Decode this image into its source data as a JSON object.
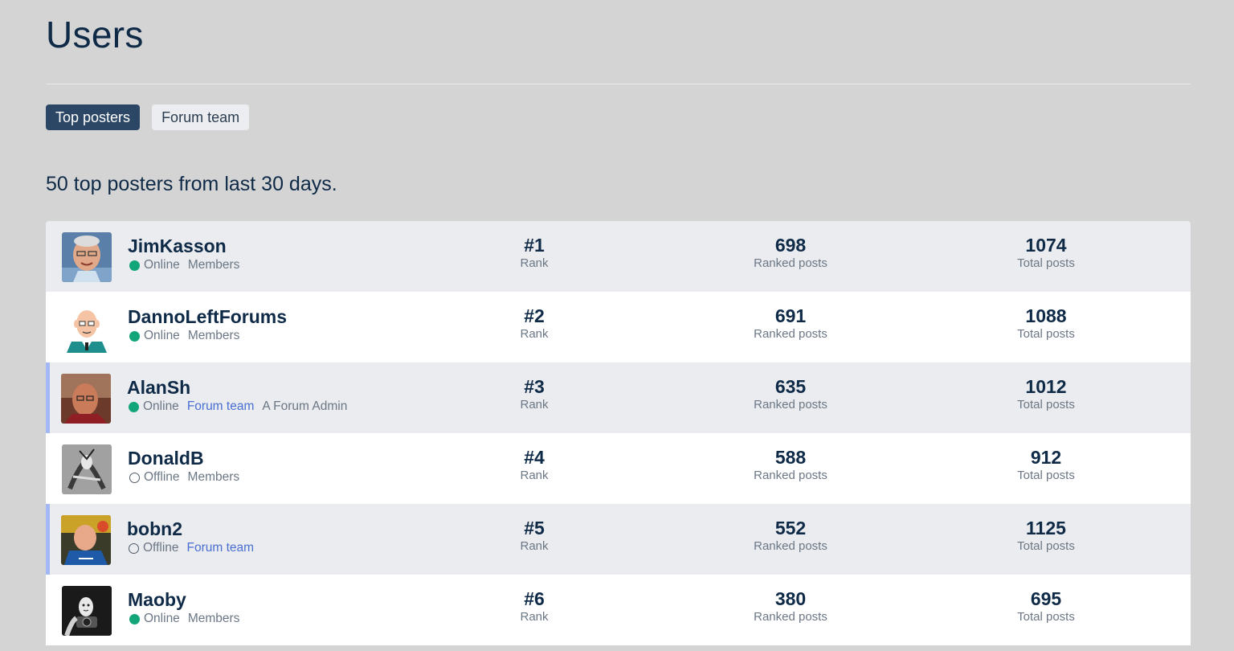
{
  "page": {
    "title": "Users"
  },
  "tabs": [
    {
      "label": "Top posters",
      "active": true
    },
    {
      "label": "Forum team",
      "active": false
    }
  ],
  "subtitle": "50 top posters from last 30 days.",
  "rows": [
    {
      "username": "JimKasson",
      "status": "Online",
      "online": true,
      "groups": [
        {
          "label": "Members",
          "link": false
        }
      ],
      "rank": "#1",
      "rank_label": "Rank",
      "ranked_posts": "698",
      "ranked_label": "Ranked posts",
      "total_posts": "1074",
      "total_label": "Total posts"
    },
    {
      "username": "DannoLeftForums",
      "status": "Online",
      "online": true,
      "groups": [
        {
          "label": "Members",
          "link": false
        }
      ],
      "rank": "#2",
      "rank_label": "Rank",
      "ranked_posts": "691",
      "ranked_label": "Ranked posts",
      "total_posts": "1088",
      "total_label": "Total posts"
    },
    {
      "username": "AlanSh",
      "status": "Online",
      "online": true,
      "groups": [
        {
          "label": "Forum team",
          "link": true
        },
        {
          "label": "A Forum Admin",
          "link": false
        }
      ],
      "rank": "#3",
      "rank_label": "Rank",
      "ranked_posts": "635",
      "ranked_label": "Ranked posts",
      "total_posts": "1012",
      "total_label": "Total posts"
    },
    {
      "username": "DonaldB",
      "status": "Offline",
      "online": false,
      "groups": [
        {
          "label": "Members",
          "link": false
        }
      ],
      "rank": "#4",
      "rank_label": "Rank",
      "ranked_posts": "588",
      "ranked_label": "Ranked posts",
      "total_posts": "912",
      "total_label": "Total posts"
    },
    {
      "username": "bobn2",
      "status": "Offline",
      "online": false,
      "groups": [
        {
          "label": "Forum team",
          "link": true
        }
      ],
      "rank": "#5",
      "rank_label": "Rank",
      "ranked_posts": "552",
      "ranked_label": "Ranked posts",
      "total_posts": "1125",
      "total_label": "Total posts"
    },
    {
      "username": "Maoby",
      "status": "Online",
      "online": true,
      "groups": [
        {
          "label": "Members",
          "link": false
        }
      ],
      "rank": "#6",
      "rank_label": "Rank",
      "ranked_posts": "380",
      "ranked_label": "Ranked posts",
      "total_posts": "695",
      "total_label": "Total posts"
    }
  ],
  "colors": {
    "background": "#d4d4d4",
    "title_text": "#0e2a47",
    "tab_active_bg": "#2c4765",
    "tab_inactive_bg": "#ebedf0",
    "online_dot": "#12a57a",
    "group_link": "#4a6fd3",
    "team_accent": "#a3b6f5"
  }
}
